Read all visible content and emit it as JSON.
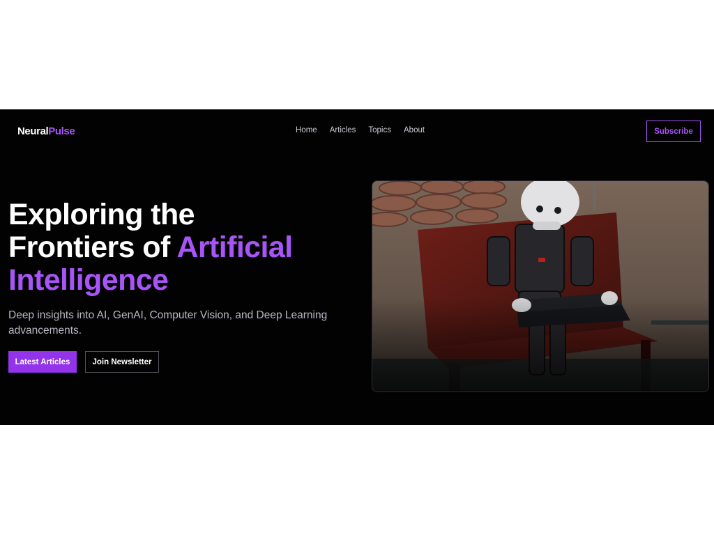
{
  "header": {
    "logo_primary": "Neural",
    "logo_accent": "Pulse",
    "nav": [
      {
        "label": "Home"
      },
      {
        "label": "Articles"
      },
      {
        "label": "Topics"
      },
      {
        "label": "About"
      }
    ],
    "subscribe_label": "Subscribe"
  },
  "hero": {
    "title_line1": "Exploring the",
    "title_line2_start": "Frontiers of ",
    "title_line2_highlight": "Artificial",
    "title_line3_highlight": "Intelligence",
    "subtitle": "Deep insights into AI, GenAI, Computer Vision, and Deep Learning advancements.",
    "primary_button": "Latest Articles",
    "secondary_button": "Join Newsletter"
  },
  "colors": {
    "background": "#030203",
    "accent": "#a855f7",
    "primary_button": "#9333ea",
    "text": "#ffffff",
    "muted_text": "#b9b7c2"
  }
}
